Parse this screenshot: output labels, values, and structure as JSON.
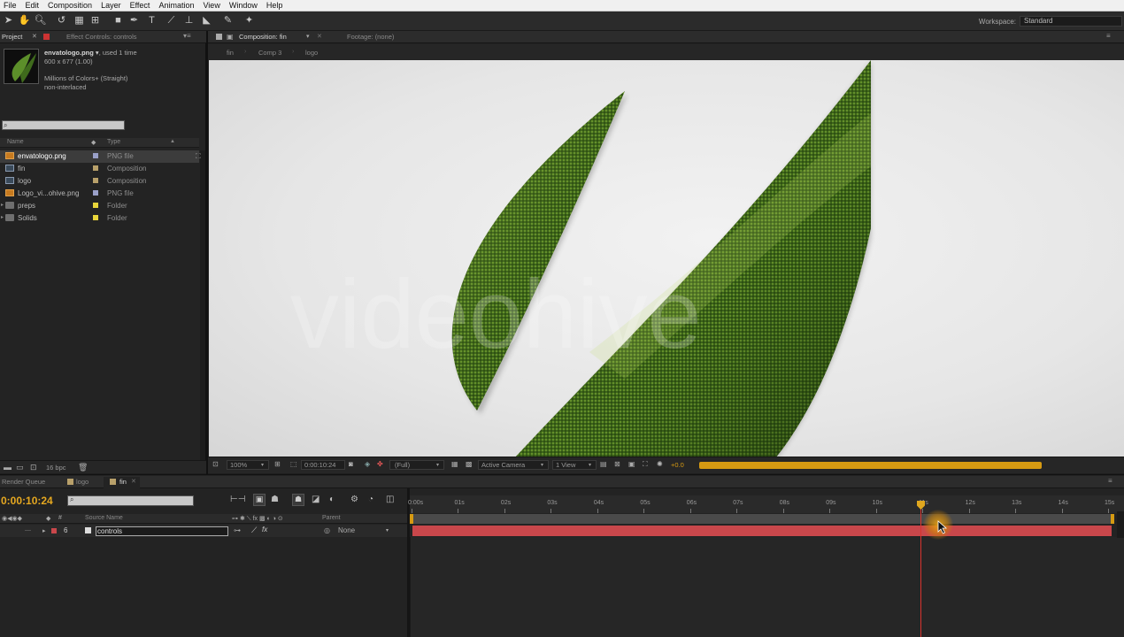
{
  "menu": [
    "File",
    "Edit",
    "Composition",
    "Layer",
    "Effect",
    "Animation",
    "View",
    "Window",
    "Help"
  ],
  "toolbar": {
    "workspace_label": "Workspace:",
    "workspace_value": "Standard"
  },
  "project_panel": {
    "tab_project": "Project",
    "tab_effect_controls": "Effect Controls: controls",
    "selected_item": {
      "name": "envatologo.png",
      "usage": ", used 1 time",
      "dimensions": "600 x 677 (1.00)",
      "color": "Millions of Colors+ (Straight)",
      "interlace": "non-interlaced"
    },
    "col_name": "Name",
    "col_type": "Type",
    "items": [
      {
        "name": "envatologo.png",
        "type": "PNG file",
        "swatch": "#9aa0c8",
        "icon": "png"
      },
      {
        "name": "fin",
        "type": "Composition",
        "swatch": "#b8a06a",
        "icon": "comp"
      },
      {
        "name": "logo",
        "type": "Composition",
        "swatch": "#b8a06a",
        "icon": "comp"
      },
      {
        "name": "Logo_vi...ohive.png",
        "type": "PNG file",
        "swatch": "#9aa0c8",
        "icon": "png"
      },
      {
        "name": "preps",
        "type": "Folder",
        "swatch": "#e8d53a",
        "icon": "folder"
      },
      {
        "name": "Solids",
        "type": "Folder",
        "swatch": "#e8d53a",
        "icon": "folder"
      }
    ],
    "bpc": "16 bpc"
  },
  "composition_panel": {
    "tab_composition": "Composition: fin",
    "tab_footage": "Footage: (none)",
    "breadcrumbs": [
      "fin",
      "Comp 3",
      "logo"
    ],
    "watermark": "videohive",
    "zoom": "100%",
    "timecode": "0:00:10:24",
    "resolution": "(Full)",
    "camera": "Active Camera",
    "views": "1 View",
    "exposure": "+0.0",
    "render_progress": 1.0
  },
  "timeline": {
    "tab_render_queue": "Render Queue",
    "tab_logo": "logo",
    "tab_fin": "fin",
    "timecode": "0:00:10:24",
    "col_source_name": "Source Name",
    "col_parent": "Parent",
    "layer": {
      "index": "6",
      "name": "controls",
      "parent": "None"
    },
    "ticks": [
      "0:00s",
      "01s",
      "02s",
      "03s",
      "04s",
      "05s",
      "06s",
      "07s",
      "08s",
      "09s",
      "10s",
      "11s",
      "12s",
      "13s",
      "14s",
      "15s"
    ],
    "playhead_seconds": 10.96,
    "duration_seconds": 15
  },
  "colors": {
    "accent_orange": "#e6a820",
    "layer_bar": "#c9474b",
    "playhead": "#d9332e"
  }
}
